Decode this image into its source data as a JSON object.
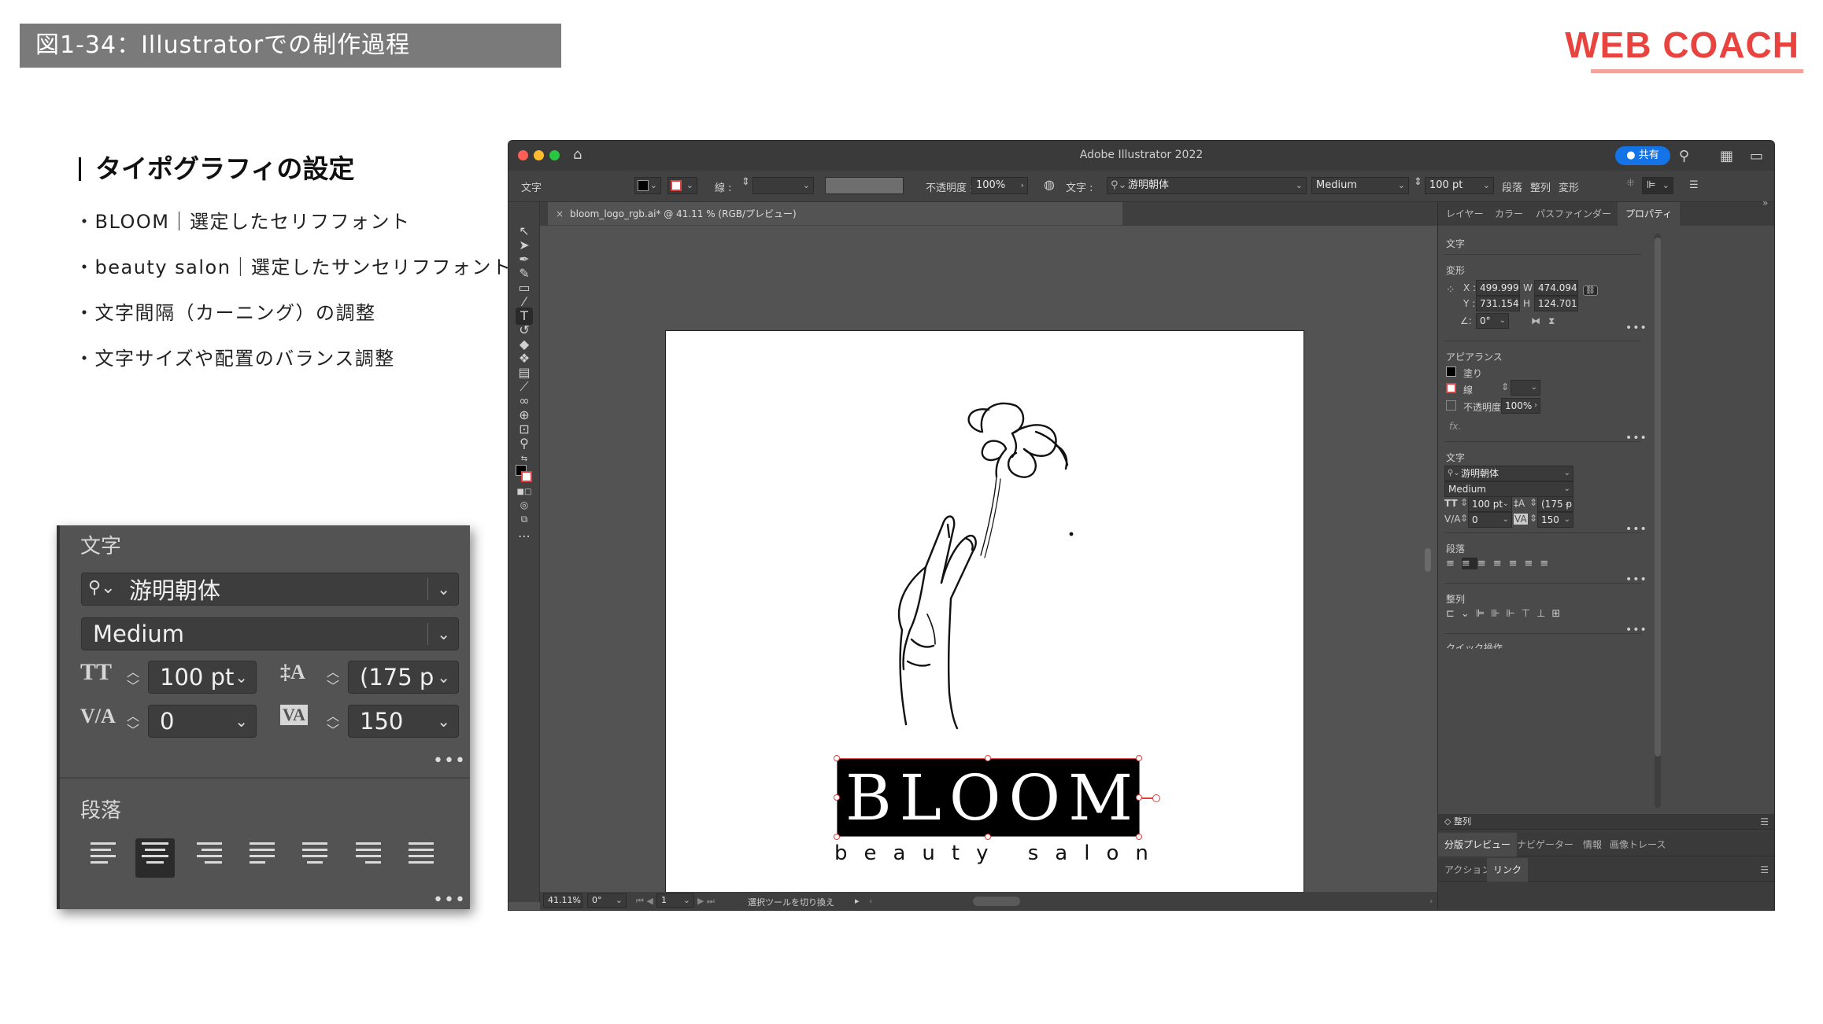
{
  "slide": {
    "figure_title": "図1-34：Illustratorでの制作過程",
    "brand": "WEB COACH",
    "brand_color": "#e8433e",
    "section_title": "タイポグラフィの設定",
    "bullets": [
      "・BLOOM｜選定したセリフフォント",
      "・beauty salon｜選定したサンセリフフォント",
      "・文字間隔（カーニング）の調整",
      "・文字サイズや配置のバランス調整"
    ]
  },
  "zoom_panel": {
    "title": "文字",
    "font_family": "游明朝体",
    "font_style": "Medium",
    "font_size": "100 pt",
    "leading": "(175 p",
    "kerning": "0",
    "tracking": "150",
    "paragraph_title": "段落",
    "more": "•••"
  },
  "window": {
    "title": "Adobe Illustrator 2022",
    "share": "共有"
  },
  "control_bar": {
    "context": "文字",
    "stroke_label": "線 :",
    "opacity_label": "不透明度 :",
    "opacity": "100%",
    "char_label": "文字 :",
    "font_family": "游明朝体",
    "font_style": "Medium",
    "font_size": "100 pt",
    "paragraph": "段落",
    "align": "整列",
    "transform": "変形"
  },
  "document": {
    "tab_title": "bloom_logo_rgb.ai* @ 41.11 % (RGB/プレビュー)",
    "close": "×",
    "logo_main": "BLOOM",
    "logo_sub": "beauty salon"
  },
  "status_bar": {
    "zoom": "41.11%",
    "rotation": "0°",
    "artboard": "1",
    "hint": "選択ツールを切り換え"
  },
  "dock": {
    "tabs": [
      "レイヤー",
      "カラー",
      "パスファインダー",
      "プロパティ"
    ],
    "props_title": "文字",
    "transform_title": "変形",
    "x_label": "X :",
    "x": "499.999",
    "y_label": "Y :",
    "y": "731.154",
    "w_label": "W :",
    "w": "474.094",
    "h_label": "H :",
    "h": "124.701",
    "angle": "0°",
    "appearance_title": "アピアランス",
    "fill_label": "塗り",
    "stroke_label": "線",
    "opacity_label": "不透明度",
    "opacity": "100%",
    "fx": "fx.",
    "char_title": "文字",
    "font_family": "游明朝体",
    "font_style": "Medium",
    "font_size": "100 pt",
    "leading": "(175 p",
    "kerning": "0",
    "tracking": "150",
    "paragraph_title": "段落",
    "align_title": "整列",
    "quick_actions": "クイック操作",
    "bottom_title": "整列",
    "bottom_tabs_1": [
      "分版プレビュー",
      "ナビゲーター",
      "情報",
      "画像トレース"
    ],
    "bottom_tabs_2": [
      "アクション",
      "リンク"
    ]
  },
  "colors": {
    "selection": "#e04040",
    "share_blue": "#1473e6",
    "panel_bg": "#535353"
  }
}
